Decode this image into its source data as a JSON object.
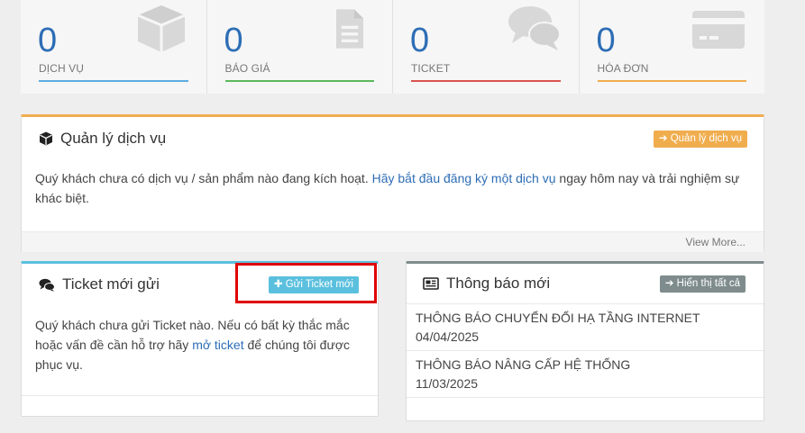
{
  "stats": [
    {
      "value": "0",
      "label": "DỊCH VỤ",
      "color": "#5dade2",
      "icon": "box-icon"
    },
    {
      "value": "0",
      "label": "BÁO GIÁ",
      "color": "#5cb85c",
      "icon": "document-icon"
    },
    {
      "value": "0",
      "label": "TICKET",
      "color": "#d9534f",
      "icon": "comments-icon"
    },
    {
      "value": "0",
      "label": "HÓA ĐƠN",
      "color": "#f0ad4e",
      "icon": "credit-card-icon"
    }
  ],
  "services_panel": {
    "title": "Quản lý dịch vụ",
    "button": "➔ Quản lý dịch vụ",
    "text_before": "Quý khách chưa có dịch vụ / sản phẩm nào đang kích hoạt. ",
    "link": "Hãy bắt đầu đăng ký một dịch vụ",
    "text_after": " ngay hôm nay và trải nghiệm sự khác biệt.",
    "footer": "View More..."
  },
  "tickets_panel": {
    "title": "Ticket mới gửi",
    "button": "✚ Gửi Ticket mới",
    "text_before": "Quý khách chưa gửi Ticket nào. Nếu có bất kỳ thắc mắc hoặc vấn đề cần hỗ trợ hãy ",
    "link": "mở ticket",
    "text_after": " để chúng tôi được phục vụ."
  },
  "news_panel": {
    "title": "Thông báo mới",
    "button": "➔ Hiển thị tất cả",
    "items": [
      {
        "title": "THÔNG BÁO CHUYỂN ĐỔI HẠ TẦNG INTERNET",
        "date": "04/04/2025"
      },
      {
        "title": "THÔNG BÁO NÂNG CẤP HỆ THỐNG",
        "date": "11/03/2025"
      }
    ]
  },
  "colors": {
    "services_accent": "#f0ad4e",
    "tickets_accent": "#5bc0de",
    "news_accent": "#7f8c8d",
    "link": "#2d6db5",
    "highlight": "#e00000"
  }
}
